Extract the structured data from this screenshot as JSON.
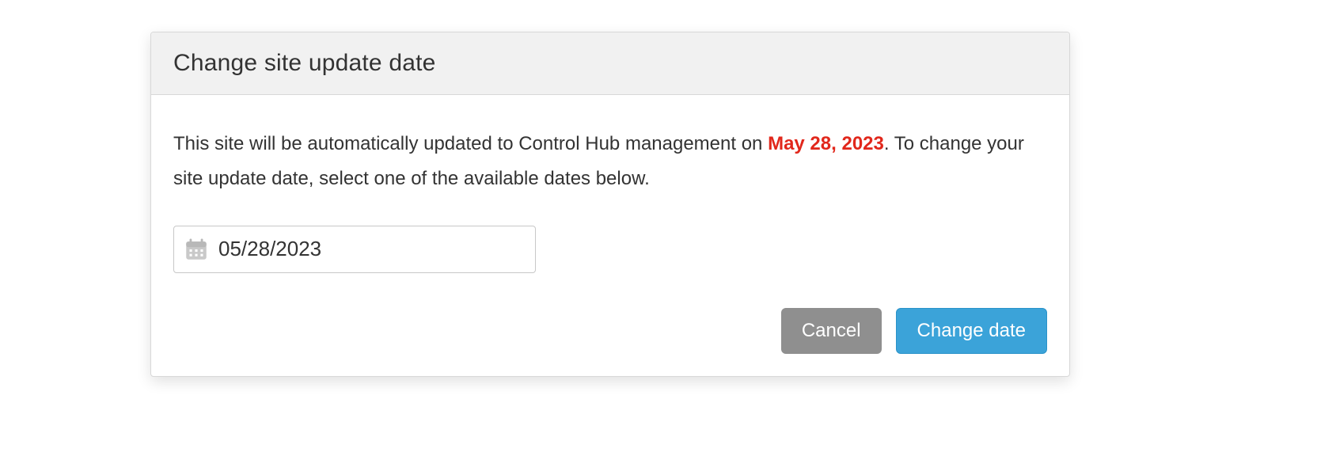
{
  "dialog": {
    "title": "Change site update date",
    "description_prefix": "This site will be automatically updated to Control Hub management on ",
    "highlight_date": "May 28, 2023",
    "description_suffix": ". To change your site update date, select one of the available dates below."
  },
  "date_input": {
    "value": "05/28/2023"
  },
  "buttons": {
    "cancel": "Cancel",
    "change_date": "Change date"
  }
}
